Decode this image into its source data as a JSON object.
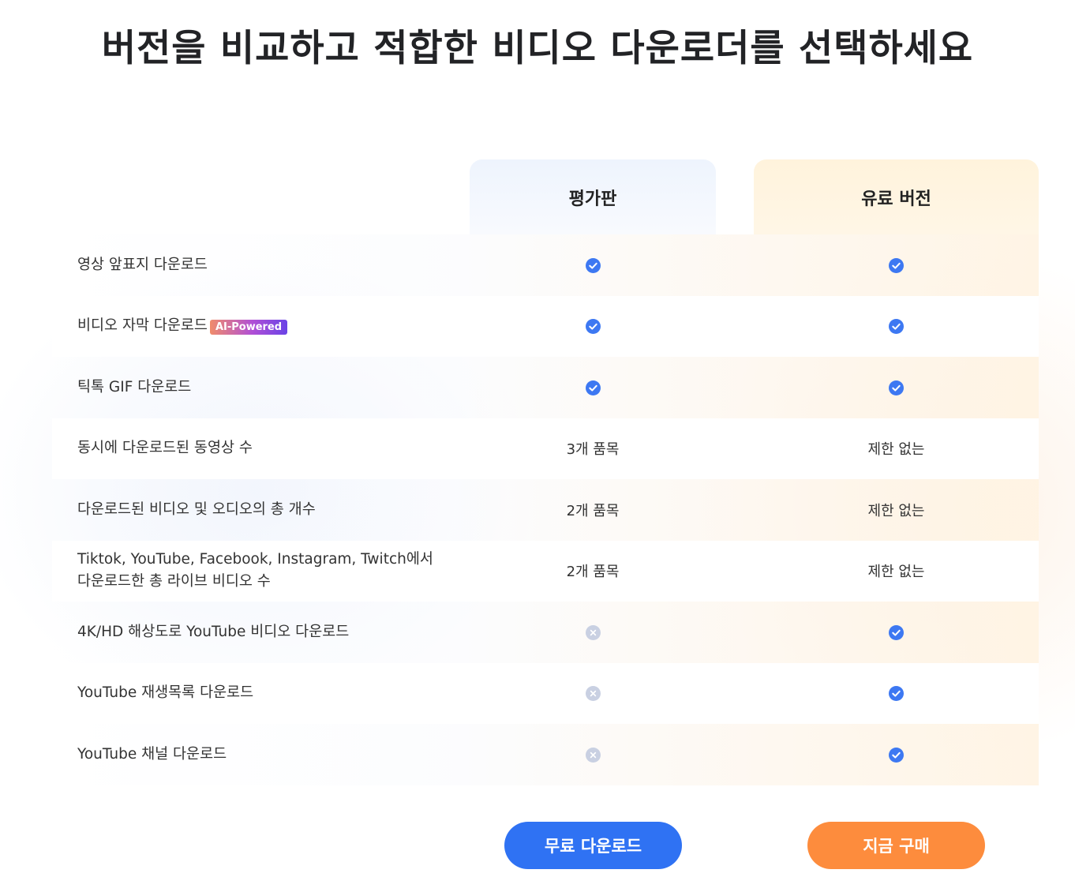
{
  "header": {
    "title": "버전을 비교하고 적합한 비디오 다운로더를 선택하세요"
  },
  "columns": {
    "trial": "평가판",
    "paid": "유료 버전"
  },
  "colors": {
    "check": "#3d78f2",
    "unavailable": "#c9d0e2",
    "free_button": "#2f72f3",
    "buy_button": "#fd8c3d"
  },
  "rows": [
    {
      "feature": "영상 앞표지 다운로드",
      "trial": "check",
      "paid": "check"
    },
    {
      "feature": "비디오 자막 다운로드",
      "badge": "AI-Powered",
      "trial": "check",
      "paid": "check"
    },
    {
      "feature": "틱톡 GIF 다운로드",
      "trial": "check",
      "paid": "check"
    },
    {
      "feature": "동시에 다운로드된 동영상 수",
      "trial": "3개 품목",
      "paid": "제한 없는"
    },
    {
      "feature": "다운로드된 비디오 및 오디오의 총 개수",
      "trial": "2개 품목",
      "paid": "제한 없는"
    },
    {
      "feature": "Tiktok, YouTube, Facebook, Instagram, Twitch에서 다운로드한 총 라이브 비디오 수",
      "trial": "2개 품목",
      "paid": "제한 없는"
    },
    {
      "feature": "4K/HD 해상도로 YouTube 비디오 다운로드",
      "trial": "cross",
      "paid": "check"
    },
    {
      "feature": "YouTube 재생목록 다운로드",
      "trial": "cross",
      "paid": "check"
    },
    {
      "feature": "YouTube 채널 다운로드",
      "trial": "cross",
      "paid": "check"
    }
  ],
  "buttons": {
    "free_label": "무료 다운로드",
    "buy_label": "지금 구매"
  }
}
